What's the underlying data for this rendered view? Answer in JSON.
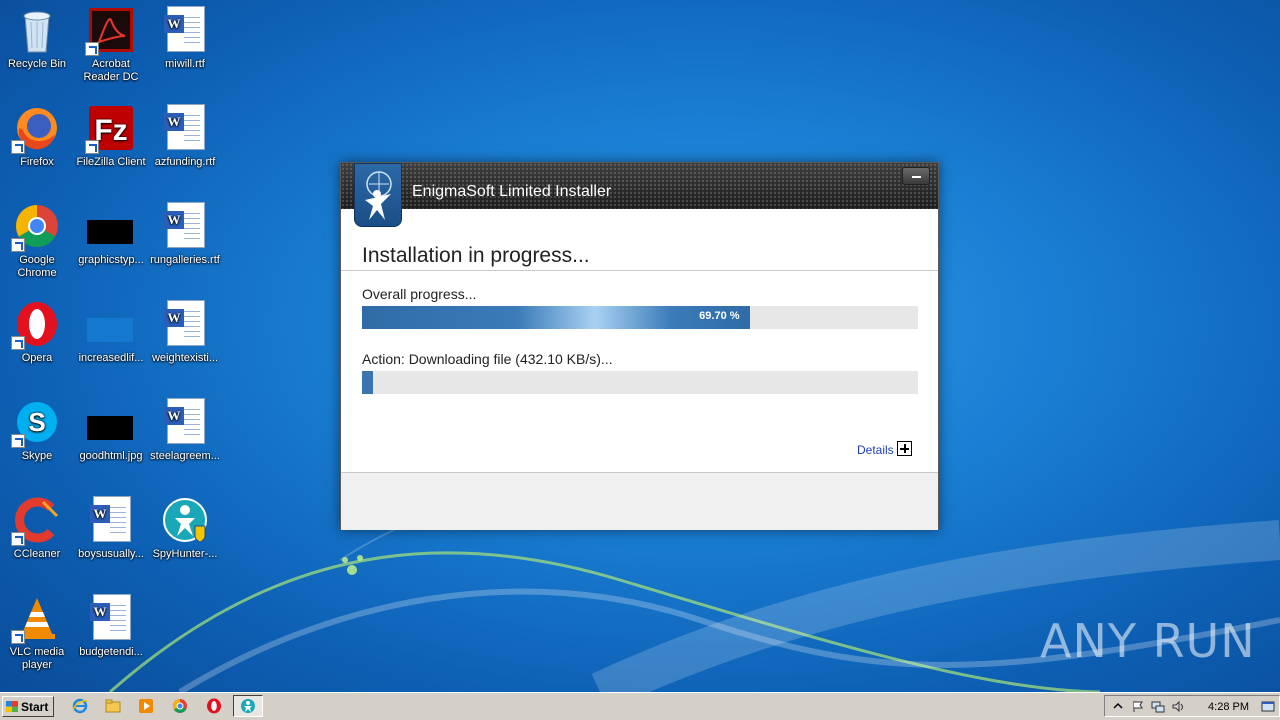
{
  "desktop": {
    "icons": [
      {
        "label": "Recycle Bin"
      },
      {
        "label": "Acrobat Reader DC"
      },
      {
        "label": "miwill.rtf"
      },
      {
        "label": "Firefox"
      },
      {
        "label": "FileZilla Client"
      },
      {
        "label": "azfunding.rtf"
      },
      {
        "label": "Google Chrome"
      },
      {
        "label": "graphicstyp..."
      },
      {
        "label": "rungalleries.rtf"
      },
      {
        "label": "Opera"
      },
      {
        "label": "increasedlif..."
      },
      {
        "label": "weightexisti..."
      },
      {
        "label": "Skype"
      },
      {
        "label": "goodhtml.jpg"
      },
      {
        "label": "steelagreem..."
      },
      {
        "label": "CCleaner"
      },
      {
        "label": "boysusually..."
      },
      {
        "label": "SpyHunter-..."
      },
      {
        "label": "VLC media player"
      },
      {
        "label": "budgetendi..."
      }
    ]
  },
  "installer": {
    "title": "EnigmaSoft Limited Installer",
    "heading": "Installation in progress...",
    "overall_label": "Overall progress...",
    "overall_percent_text": "69.70 %",
    "overall_fraction": 0.697,
    "action_label": "Action: Downloading file (432.10 KB/s)...",
    "action_fraction": 0.02,
    "details_label": "Details"
  },
  "taskbar": {
    "start_label": "Start",
    "clock": "4:28 PM",
    "pinned": [
      "internet-explorer-icon",
      "explorer-icon",
      "media-player-icon",
      "chrome-icon",
      "opera-icon",
      "spyhunter-icon"
    ]
  },
  "watermark": "ANY RUN",
  "colors": {
    "progress": "#3a7bb8",
    "link": "#1f3fb0",
    "desktop": "#1a7fd4"
  }
}
